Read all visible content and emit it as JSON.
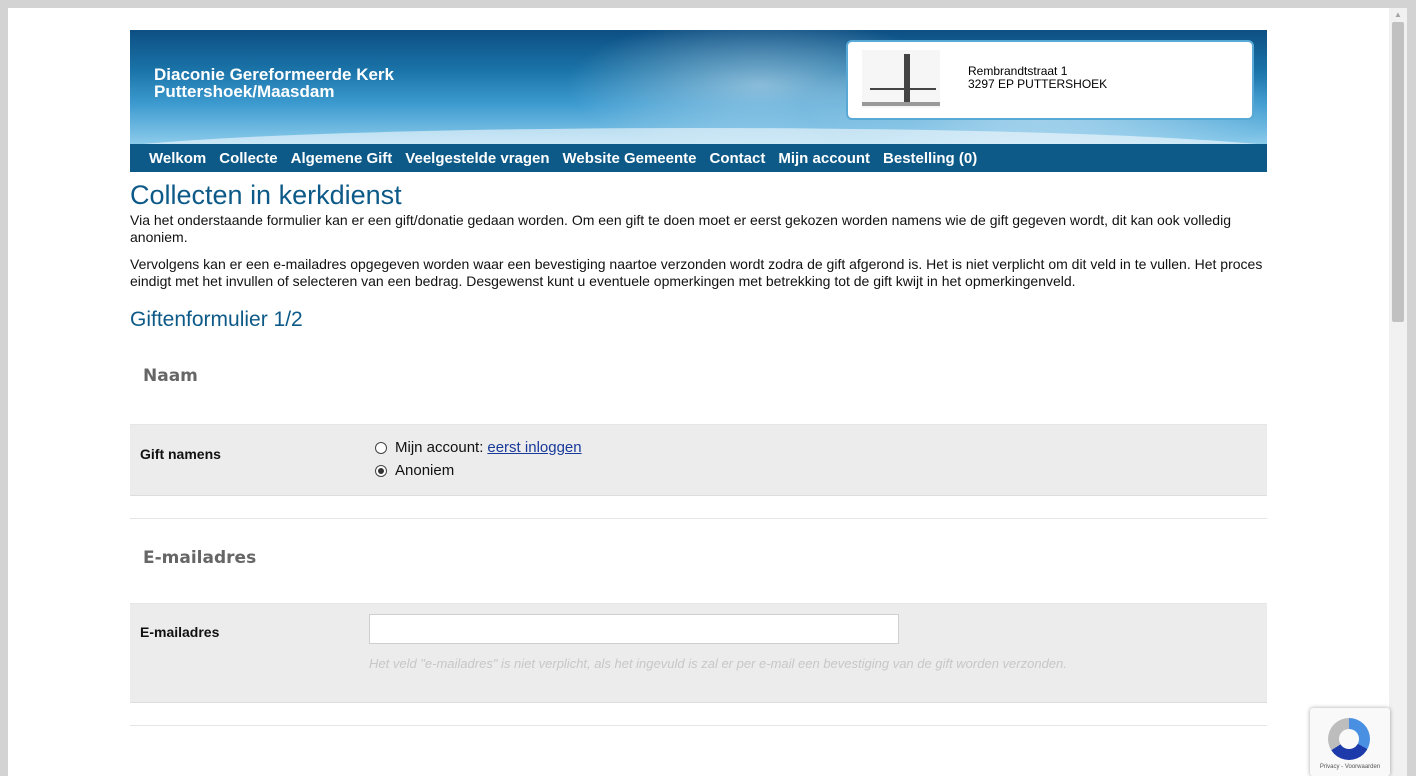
{
  "site": {
    "title_line1": "Diaconie Gereformeerde Kerk",
    "title_line2": "Puttershoek/Maasdam",
    "address_line1": "Rembrandtstraat 1",
    "address_line2": "3297 EP PUTTERSHOEK"
  },
  "nav": {
    "items": [
      "Welkom",
      "Collecte",
      "Algemene Gift",
      "Veelgestelde vragen",
      "Website Gemeente",
      "Contact",
      "Mijn account",
      "Bestelling (0)"
    ]
  },
  "content": {
    "title": "Collecten in kerkdienst",
    "intro1": "Via het onderstaande formulier kan er een gift/donatie gedaan worden. Om een gift te doen moet er eerst gekozen worden namens wie de gift gegeven wordt, dit kan ook volledig anoniem.",
    "intro2": "Vervolgens kan er een e-mailadres opgegeven worden waar een bevestiging naartoe verzonden wordt zodra de gift afgerond is. Het is niet verplicht om dit veld in te vullen. Het proces eindigt met het invullen of selecteren van een bedrag. Desgewenst kunt u eventuele opmerkingen met betrekking tot de gift kwijt in het opmerkingenveld.",
    "form_title": "Giftenformulier 1/2"
  },
  "form": {
    "section_name": "Naam",
    "gift_label": "Gift namens",
    "option_account": "Mijn account:",
    "option_account_link": "eerst inloggen",
    "option_anonymous": "Anoniem",
    "selected": "Anoniem",
    "section_email": "E-mailadres",
    "email_label": "E-mailadres",
    "email_value": "",
    "email_hint": "Het veld \"e-mailadres\" is niet verplicht, als het ingevuld is zal er per e-mail een bevestiging van de gift worden verzonden."
  },
  "recaptcha": {
    "text": "Privacy - Voorwaarden"
  }
}
